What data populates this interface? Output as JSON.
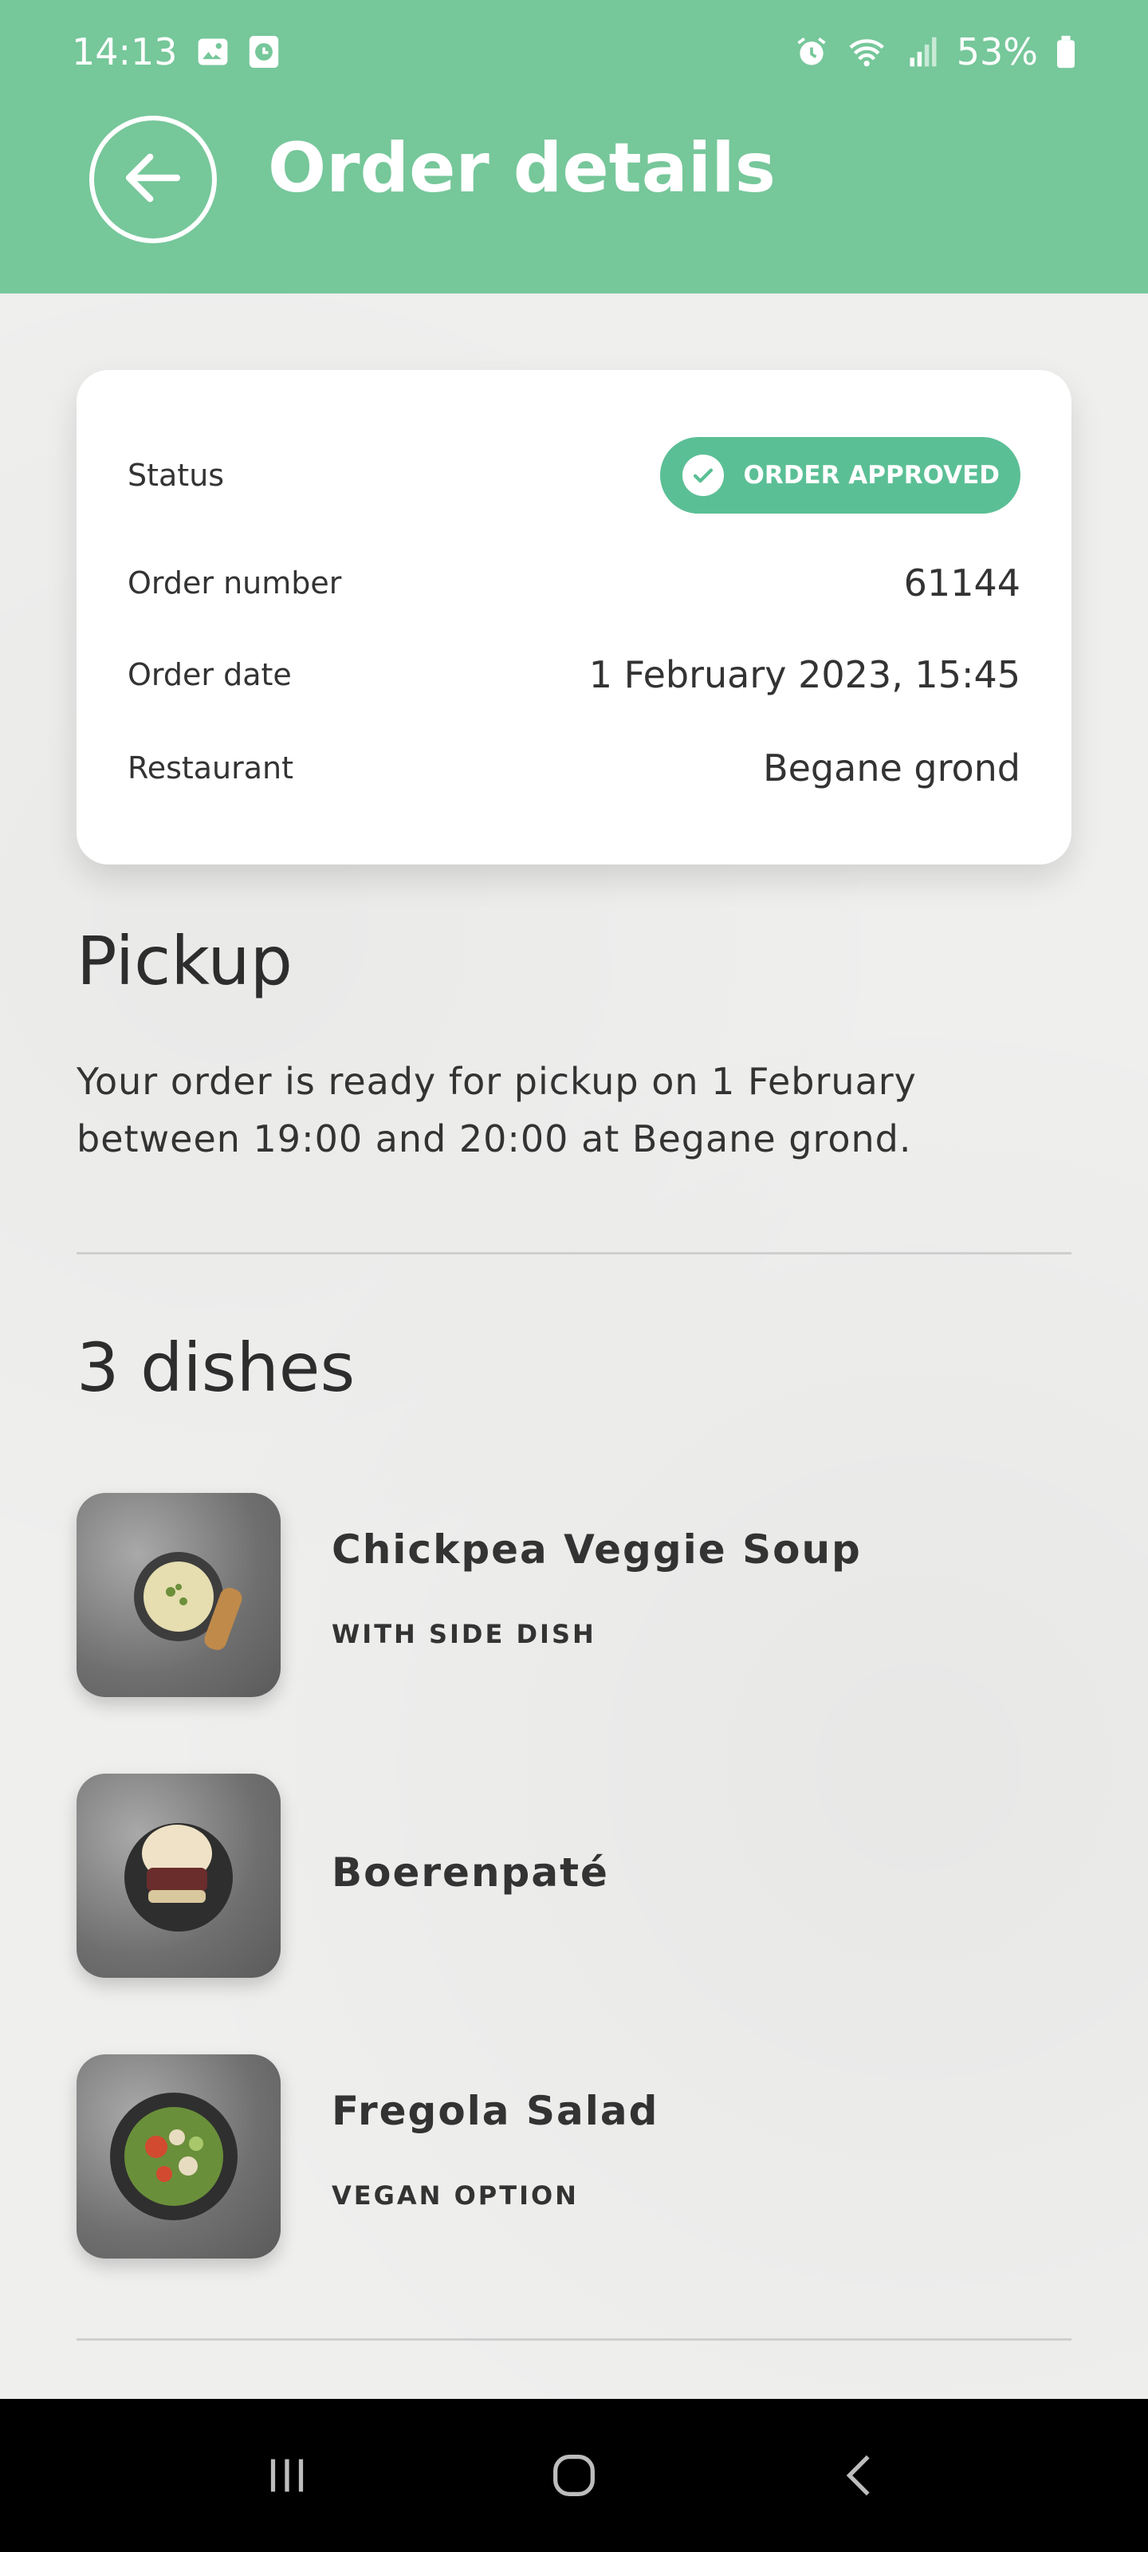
{
  "status_bar": {
    "time": "14:13",
    "battery": "53%",
    "icons": [
      "image-icon",
      "clock-app-icon",
      "alarm-icon",
      "wifi-icon",
      "signal-icon",
      "battery-icon"
    ]
  },
  "header": {
    "title": "Order details",
    "back_icon": "arrow-left-icon",
    "color": "#76c79a"
  },
  "order_card": {
    "status_label": "Status",
    "status_value": "ORDER APPROVED",
    "status_color": "#5bbf95",
    "order_number_label": "Order number",
    "order_number_value": "61144",
    "order_date_label": "Order date",
    "order_date_value": "1 February 2023, 15:45",
    "restaurant_label": "Restaurant",
    "restaurant_value": "Begane grond"
  },
  "pickup": {
    "title": "Pickup",
    "text": "Your order is ready for pickup on 1 February between 19:00 and 20:00 at Begane grond."
  },
  "dishes": {
    "title": "3 dishes",
    "items": [
      {
        "name": "Chickpea Veggie Soup",
        "subtitle": "WITH SIDE DISH"
      },
      {
        "name": "Boerenpaté",
        "subtitle": ""
      },
      {
        "name": "Fregola Salad",
        "subtitle": "VEGAN OPTION"
      }
    ]
  },
  "navbar": {
    "icons": [
      "recent-apps-icon",
      "home-icon",
      "back-icon"
    ]
  }
}
